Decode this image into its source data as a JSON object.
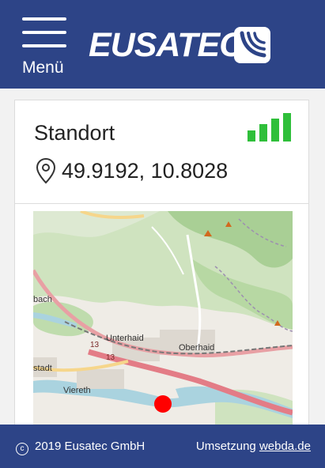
{
  "header": {
    "menu_label": "Menü",
    "logo_text": "EUSATEC",
    "logo_mark_icon": "eusatec-wave-logo-icon",
    "background": "#2d4487"
  },
  "card": {
    "title": "Standort",
    "coordinates": "49.9192, 10.8028",
    "signal_icon": "signal-strength-icon",
    "signal_color": "#2fbf3a",
    "pin_icon": "location-pin-icon"
  },
  "map": {
    "labels": {
      "unterhaid": "Unterhaid",
      "oberhaid": "Oberhaid",
      "viereth": "Viereth",
      "bach_fragment": "bach",
      "stadt_fragment": "stadt",
      "road_13_a": "13",
      "road_13_b": "13"
    },
    "marker_color": "#ff0000",
    "marker_icon": "location-marker-icon"
  },
  "footer": {
    "copyright": "2019 Eusatec GmbH",
    "credit_prefix": "Umsetzung",
    "credit_link": "webda.de"
  }
}
